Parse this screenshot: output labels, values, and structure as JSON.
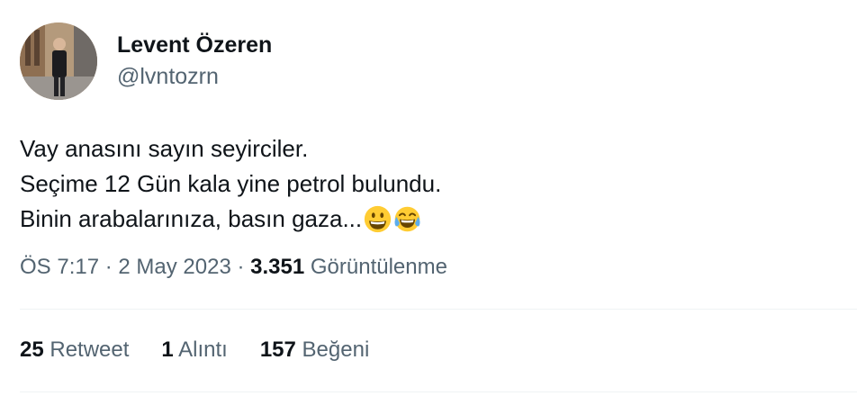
{
  "user": {
    "display_name": "Levent Özeren",
    "handle": "@lvntozrn"
  },
  "tweet": {
    "line1": "Vay anasını sayın seyirciler.",
    "line2": "Seçime 12 Gün kala yine petrol bulundu.",
    "line3": "Binin arabalarınıza, basın gaza...",
    "emojis": [
      "grinning-face-emoji",
      "tears-of-joy-emoji"
    ]
  },
  "meta": {
    "time": "ÖS 7:17",
    "sep": " · ",
    "date": "2 May 2023",
    "views_count": "3.351",
    "views_label": "Görüntülenme"
  },
  "stats": {
    "retweets_count": "25",
    "retweets_label": "Retweet",
    "quotes_count": "1",
    "quotes_label": "Alıntı",
    "likes_count": "157",
    "likes_label": "Beğeni"
  },
  "colors": {
    "text_primary": "#0f1419",
    "text_secondary": "#536471",
    "divider": "#eff3f4",
    "emoji_yellow": "#ffcc33"
  }
}
